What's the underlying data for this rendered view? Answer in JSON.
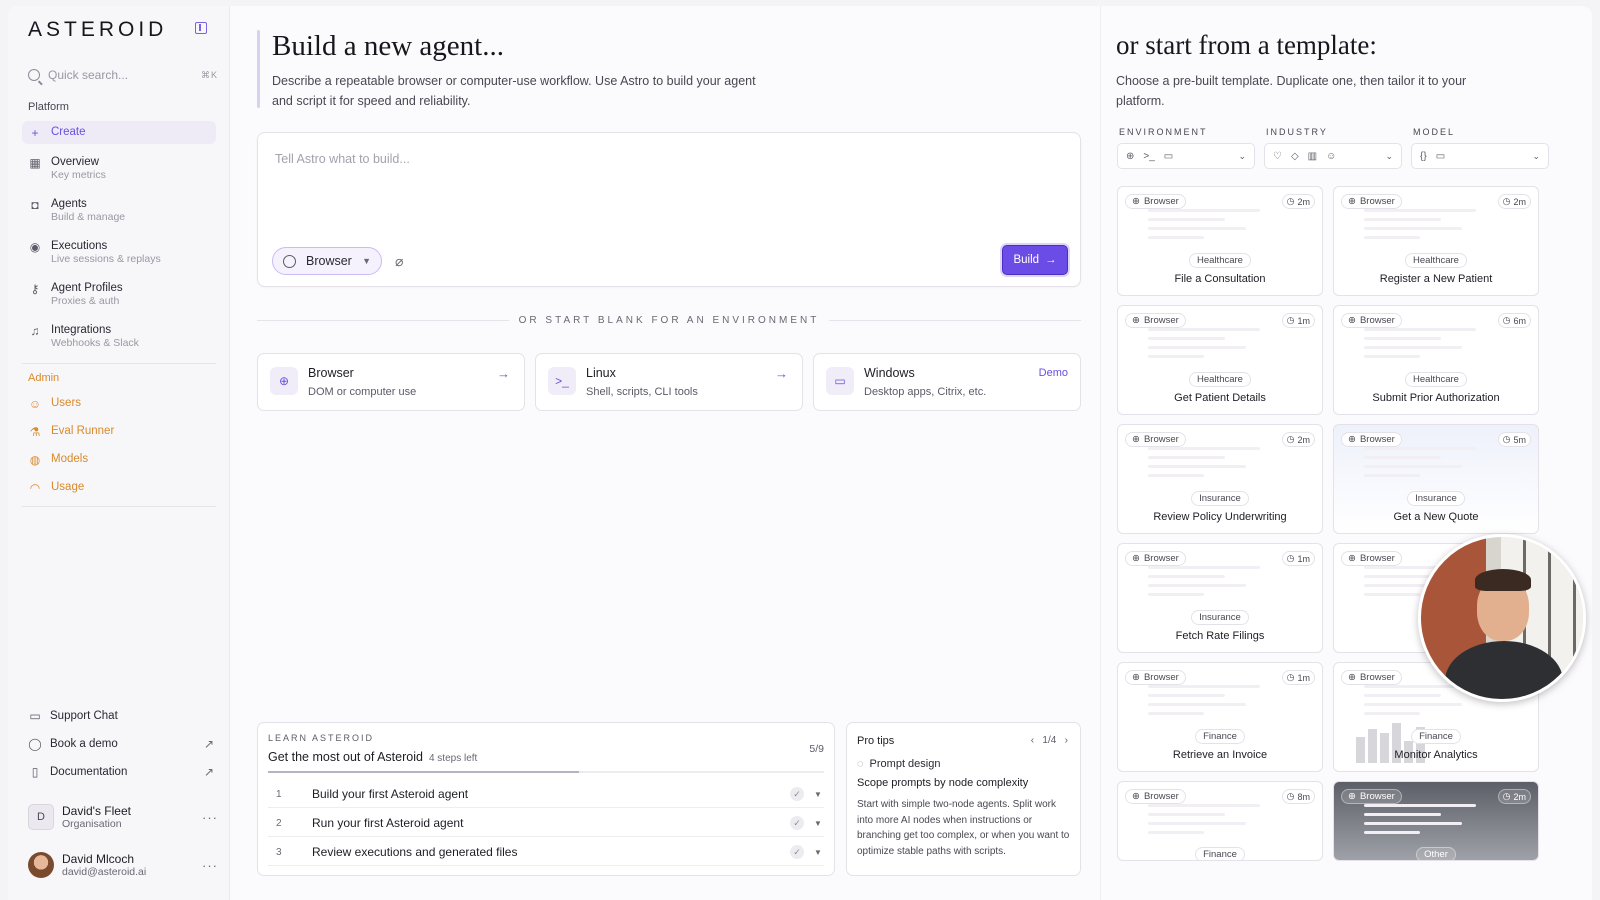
{
  "sidebar": {
    "logo": "ASTEROID",
    "search_placeholder": "Quick search...",
    "search_shortcut": "⌘K",
    "platform_label": "Platform",
    "items": [
      {
        "label": "Create",
        "sub": "",
        "icon": "plus-icon"
      },
      {
        "label": "Overview",
        "sub": "Key metrics",
        "icon": "grid-icon"
      },
      {
        "label": "Agents",
        "sub": "Build & manage",
        "icon": "robot-icon"
      },
      {
        "label": "Executions",
        "sub": "Live sessions & replays",
        "icon": "play-icon"
      },
      {
        "label": "Agent Profiles",
        "sub": "Proxies & auth",
        "icon": "key-icon"
      },
      {
        "label": "Integrations",
        "sub": "Webhooks & Slack",
        "icon": "bell-icon"
      }
    ],
    "admin_label": "Admin",
    "admin_items": [
      {
        "label": "Users",
        "icon": "users-icon"
      },
      {
        "label": "Eval Runner",
        "icon": "flask-icon"
      },
      {
        "label": "Models",
        "icon": "brain-icon"
      },
      {
        "label": "Usage",
        "icon": "gauge-icon"
      }
    ],
    "bottom_items": [
      {
        "label": "Support Chat",
        "icon": "chat-icon"
      },
      {
        "label": "Book a demo",
        "icon": "message-icon"
      },
      {
        "label": "Documentation",
        "icon": "book-icon"
      }
    ],
    "org": {
      "initial": "D",
      "name": "David's Fleet",
      "sub": "Organisation"
    },
    "user": {
      "name": "David Mlcoch",
      "email": "david@asteroid.ai"
    }
  },
  "main": {
    "title": "Build a new agent...",
    "description": "Describe a repeatable browser or computer-use workflow. Use Astro to build your agent and script it for speed and reliability.",
    "prompt_placeholder": "Tell Astro what to build...",
    "env_value": "Browser",
    "build_label": "Build",
    "or_text": "OR START BLANK FOR AN ENVIRONMENT",
    "env_cards": [
      {
        "title": "Browser",
        "sub": "DOM or computer use",
        "icon": "globe-icon"
      },
      {
        "title": "Linux",
        "sub": "Shell, scripts, CLI tools",
        "icon": "terminal-icon"
      },
      {
        "title": "Windows",
        "sub": "Desktop apps, Citrix, etc.",
        "icon": "monitor-icon",
        "badge": "Demo"
      }
    ],
    "learn": {
      "caption": "LEARN ASTEROID",
      "heading": "Get the most out of Asteroid",
      "steps_left": "4 steps left",
      "count": "5/9",
      "progress": 0.56,
      "steps": [
        {
          "n": "1",
          "label": "Build your first Asteroid agent"
        },
        {
          "n": "2",
          "label": "Run your first Asteroid agent"
        },
        {
          "n": "3",
          "label": "Review executions and generated files"
        }
      ]
    },
    "tips": {
      "heading": "Pro tips",
      "page": "1/4",
      "category": "Prompt design",
      "title": "Scope prompts by node complexity",
      "body": "Start with simple two-node agents. Split work into more AI nodes when instructions or branching get too complex, or when you want to optimize stable paths with scripts."
    }
  },
  "templates": {
    "title": "or start from a template:",
    "description": "Choose a pre-built template. Duplicate one, then tailor it to your platform.",
    "filters": {
      "environment": "ENVIRONMENT",
      "industry": "INDUSTRY",
      "model": "MODEL"
    },
    "cards": [
      {
        "env": "Browser",
        "time": "2m",
        "tag": "Healthcare",
        "name": "File a Consultation"
      },
      {
        "env": "Browser",
        "time": "2m",
        "tag": "Healthcare",
        "name": "Register a New Patient"
      },
      {
        "env": "Browser",
        "time": "1m",
        "tag": "Healthcare",
        "name": "Get Patient Details"
      },
      {
        "env": "Browser",
        "time": "6m",
        "tag": "Healthcare",
        "name": "Submit Prior Authorization"
      },
      {
        "env": "Browser",
        "time": "2m",
        "tag": "Insurance",
        "name": "Review Policy Underwriting"
      },
      {
        "env": "Browser",
        "time": "5m",
        "tag": "Insurance",
        "name": "Get a New Quote"
      },
      {
        "env": "Browser",
        "time": "1m",
        "tag": "Insurance",
        "name": "Fetch Rate Filings"
      },
      {
        "env": "Browser",
        "time": "",
        "tag": "",
        "name": ""
      },
      {
        "env": "Browser",
        "time": "1m",
        "tag": "Finance",
        "name": "Retrieve an Invoice"
      },
      {
        "env": "Browser",
        "time": "",
        "tag": "Finance",
        "name": "Monitor Analytics"
      },
      {
        "env": "Browser",
        "time": "8m",
        "tag": "Finance",
        "name": ""
      },
      {
        "env": "Browser",
        "time": "2m",
        "tag": "Other",
        "name": ""
      }
    ]
  },
  "colors": {
    "accent": "#6c4ce6",
    "admin": "#d98a2b"
  }
}
